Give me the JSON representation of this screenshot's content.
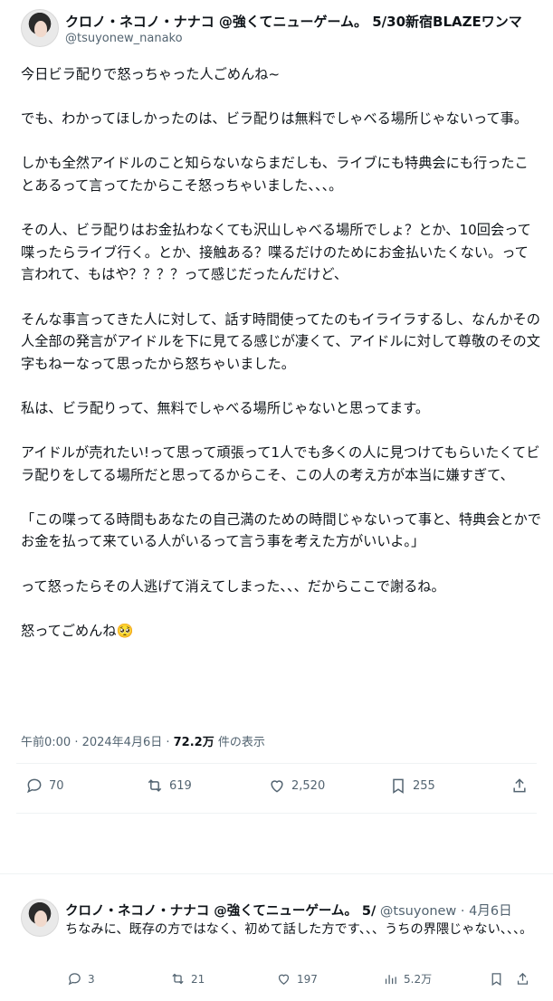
{
  "main": {
    "name_line": "クロノ・ネコノ・ナナコ @強くてニューゲーム。 5/30新宿BLAZEワンマ",
    "handle": "@tsuyonew_nanako",
    "text": "今日ビラ配りで怒っちゃった人ごめんね~\n\nでも、わかってほしかったのは、ビラ配りは無料でしゃべる場所じゃないって事。\n\nしかも全然アイドルのこと知らないならまだしも、ライブにも特典会にも行ったことあるって言ってたからこそ怒っちゃいました、、、。\n\nその人、ビラ配りはお金払わなくても沢山しゃべる場所でしょ？とか、10回会って喋ったらライブ行く。とか、接触ある？喋るだけのためにお金払いたくない。って言われて、もはや？？？？って感じだったんだけど、\n\nそんな事言ってきた人に対して、話す時間使ってたのもイライラするし、なんかその人全部の発言がアイドルを下に見てる感じが凄くて、アイドルに対して尊敬のその文字もねーなって思ったから怒ちゃいました。\n\n私は、ビラ配りって、無料でしゃべる場所じゃないと思ってます。\n\nアイドルが売れたい!って思って頑張って1人でも多くの人に見つけてもらいたくてビラ配りをしてる場所だと思ってるからこそ、この人の考え方が本当に嫌すぎて、\n\n「この喋ってる時間もあなたの自己満のための時間じゃないって事と、特典会とかでお金を払って来ている人がいるって言う事を考えた方がいいよ。」\n\nって怒ったらその人逃げて消えてしまった、、、だからここで謝るね。\n\n怒ってごめんね🥺",
    "time": "午前0:00 · 2024年4月6日 · ",
    "views": "72.2万",
    "views_suffix": " 件の表示",
    "actions": {
      "replies": "70",
      "retweets": "619",
      "likes": "2,520",
      "bookmarks": "255"
    }
  },
  "reply": {
    "name": "クロノ・ネコノ・ナナコ @強くてニューゲーム。 5/",
    "sub": " @tsuyonew · 4月6日",
    "text": "ちなみに、既存の方ではなく、初めて話した方です、、、うちの界隈じゃない、、、。",
    "actions": {
      "replies": "3",
      "retweets": "21",
      "likes": "197",
      "views": "5.2万"
    }
  },
  "icons": [
    "reply-icon",
    "retweet-icon",
    "like-icon",
    "bookmark-icon",
    "share-icon",
    "views-icon",
    "more-icon"
  ],
  "colors": {
    "text": "#0f1419",
    "muted": "#536471",
    "divider": "#eff3f4"
  }
}
